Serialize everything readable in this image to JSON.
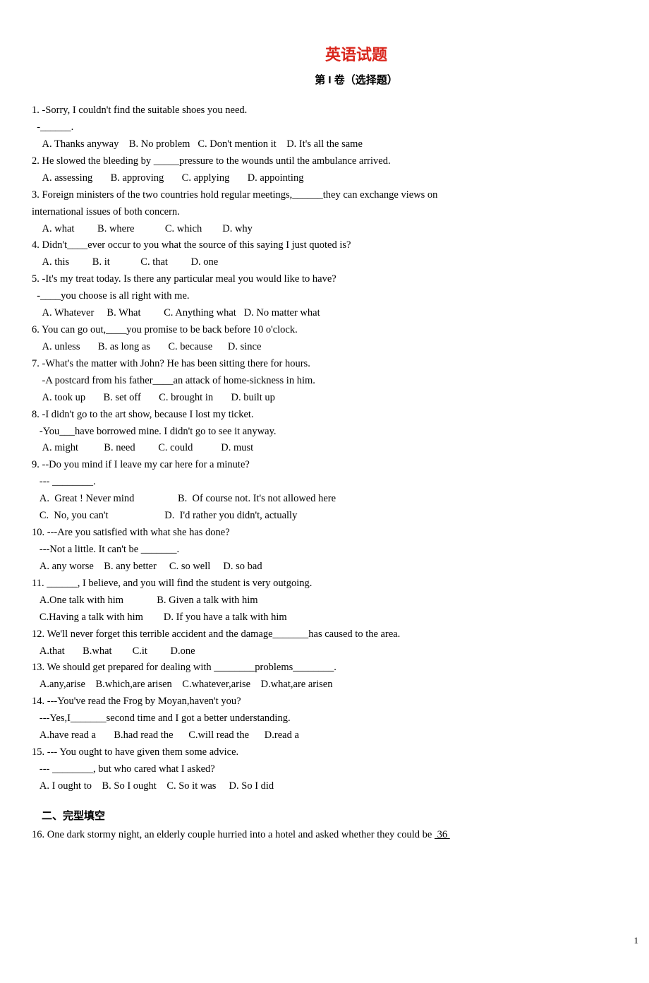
{
  "title": "英语试题",
  "subtitle": "第 I 卷（选择题）",
  "questions": [
    {
      "n": "1",
      "lines": [
        "1. -Sorry, I couldn't find the suitable shoes you need.",
        "  -______.",
        "    A. Thanks anyway    B. No problem   C. Don't mention it    D. It's all the same"
      ]
    },
    {
      "n": "2",
      "lines": [
        "2. He slowed the bleeding by _____pressure to the wounds until the ambulance arrived.",
        "    A. assessing       B. approving       C. applying       D. appointing"
      ]
    },
    {
      "n": "3",
      "lines": [
        "3. Foreign ministers of the two countries hold regular meetings,______they can exchange views on",
        "international issues of both concern.",
        "    A. what         B. where            C. which        D. why"
      ]
    },
    {
      "n": "4",
      "lines": [
        "4. Didn't____ever occur to you what the source of this saying I just quoted is?",
        "    A. this         B. it            C. that         D. one"
      ]
    },
    {
      "n": "5",
      "lines": [
        "5. -It's my treat today. Is there any particular meal you would like to have?",
        "  -____you choose is all right with me.",
        "    A. Whatever     B. What         C. Anything what   D. No matter what"
      ]
    },
    {
      "n": "6",
      "lines": [
        "6. You can go out,____you promise to be back before 10 o'clock.",
        "    A. unless       B. as long as       C. because      D. since"
      ]
    },
    {
      "n": "7",
      "lines": [
        "7. -What's the matter with John? He has been sitting there for hours.",
        "    -A postcard from his father____an attack of home-sickness in him.",
        "    A. took up       B. set off       C. brought in       D. built up"
      ]
    },
    {
      "n": "8",
      "lines": [
        "8. -I didn't go to the art show, because I lost my ticket.",
        "   -You___have borrowed mine. I didn't go to see it anyway.",
        "    A. might          B. need         C. could           D. must"
      ]
    },
    {
      "n": "9",
      "lines": [
        "9. --Do you mind if I leave my car here for a minute?",
        "   --- ________.",
        "   A.  Great ! Never mind                 B.  Of course not. It's not allowed here",
        "   C.  No, you can't                      D.  I'd rather you didn't, actually"
      ]
    },
    {
      "n": "10",
      "lines": [
        "10. ---Are you satisfied with what she has done?",
        "   ---Not a little. It can't be _______.",
        "   A. any worse    B. any better     C. so well     D. so bad"
      ]
    },
    {
      "n": "11",
      "lines": [
        "11. ______, I believe, and you will find the student is very outgoing.",
        "   A.One talk with him             B. Given a talk with him",
        "   C.Having a talk with him        D. If you have a talk with him"
      ]
    },
    {
      "n": "12",
      "lines": [
        "12. We'll never forget this terrible accident and the damage_______has caused to the area.",
        "   A.that       B.what        C.it         D.one"
      ]
    },
    {
      "n": "13",
      "lines": [
        "13. We should get prepared for dealing with ________problems________.",
        "   A.any,arise    B.which,are arisen    C.whatever,arise    D.what,are arisen"
      ]
    },
    {
      "n": "14",
      "lines": [
        "14. ---You've read the Frog by Moyan,haven't you?",
        "   ---Yes,I_______second time and I got a better understanding.",
        "   A.have read a       B.had read the      C.will read the      D.read a"
      ]
    },
    {
      "n": "15",
      "lines": [
        "15. --- You ought to have given them some advice.",
        "   --- ________, but who cared what I asked?",
        "   A. I ought to    B. So I ought    C. So it was     D. So I did"
      ]
    }
  ],
  "section2_head": "二、完型填空",
  "q16_prefix": "16. One dark stormy night, an elderly couple hurried into a hotel and asked whether they could be ",
  "q16_blank": " 36 ",
  "page_number": "1"
}
